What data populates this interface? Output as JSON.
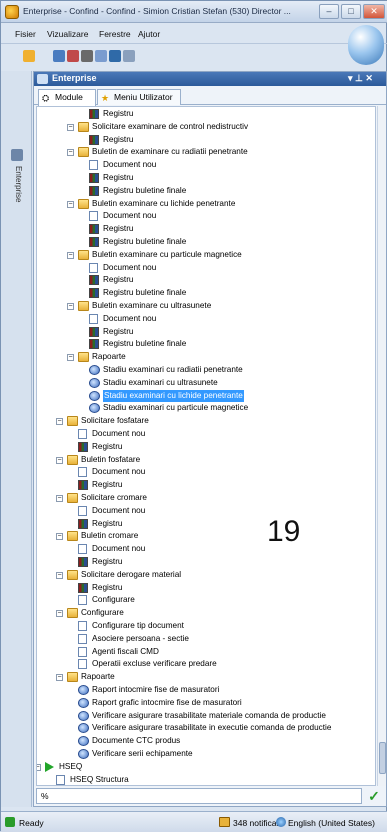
{
  "window": {
    "title": "Enterprise - Confind - Confind - Simion Cristian Stefan (530) Director ...",
    "min_label": "–",
    "max_label": "□",
    "close_label": "✕"
  },
  "menu": [
    "Fisier",
    "Vizualizare",
    "Ferestre",
    "Ajutor"
  ],
  "sidebar": {
    "tab_label": "Enterprise"
  },
  "panel": {
    "title": "Enterprise",
    "pin_label": "▾ ⊥ ✕",
    "tabs": [
      "Module",
      "Meniu Utilizator"
    ]
  },
  "tree": [
    {
      "label": "Registru",
      "icon": "register-icon",
      "level": 4,
      "expander": ""
    },
    {
      "label": "Solicitare examinare de control nedistructiv",
      "icon": "folder-icon",
      "level": 3,
      "expander": "−"
    },
    {
      "label": "Registru",
      "icon": "register-icon",
      "level": 4,
      "expander": ""
    },
    {
      "label": "Buletin de examinare cu radiatii penetrante",
      "icon": "folder-icon",
      "level": 3,
      "expander": "−"
    },
    {
      "label": "Document nou",
      "icon": "document-icon",
      "level": 4,
      "expander": ""
    },
    {
      "label": "Registru",
      "icon": "register-icon",
      "level": 4,
      "expander": ""
    },
    {
      "label": "Registru buletine finale",
      "icon": "register-icon",
      "level": 4,
      "expander": ""
    },
    {
      "label": "Buletin examinare cu lichide penetrante",
      "icon": "folder-icon",
      "level": 3,
      "expander": "−"
    },
    {
      "label": "Document nou",
      "icon": "document-icon",
      "level": 4,
      "expander": ""
    },
    {
      "label": "Registru",
      "icon": "register-icon",
      "level": 4,
      "expander": ""
    },
    {
      "label": "Registru buletine finale",
      "icon": "register-icon",
      "level": 4,
      "expander": ""
    },
    {
      "label": "Buletin examinare cu particule magnetice",
      "icon": "folder-icon",
      "level": 3,
      "expander": "−"
    },
    {
      "label": "Document nou",
      "icon": "document-icon",
      "level": 4,
      "expander": ""
    },
    {
      "label": "Registru",
      "icon": "register-icon",
      "level": 4,
      "expander": ""
    },
    {
      "label": "Registru buletine finale",
      "icon": "register-icon",
      "level": 4,
      "expander": ""
    },
    {
      "label": "Buletin examinare cu ultrasunete",
      "icon": "folder-icon",
      "level": 3,
      "expander": "−"
    },
    {
      "label": "Document nou",
      "icon": "document-icon",
      "level": 4,
      "expander": ""
    },
    {
      "label": "Registru",
      "icon": "register-icon",
      "level": 4,
      "expander": ""
    },
    {
      "label": "Registru buletine finale",
      "icon": "register-icon",
      "level": 4,
      "expander": ""
    },
    {
      "label": "Rapoarte",
      "icon": "folder-icon",
      "level": 3,
      "expander": "−"
    },
    {
      "label": "Stadiu examinari cu radiatii penetrante",
      "icon": "report-icon",
      "level": 4,
      "expander": ""
    },
    {
      "label": "Stadiu examinari cu ultrasunete",
      "icon": "report-icon",
      "level": 4,
      "expander": ""
    },
    {
      "label": "Stadiu examinari cu lichide penetrante",
      "icon": "report-icon",
      "level": 4,
      "expander": "",
      "selected": true
    },
    {
      "label": "Stadiu examinari cu particule magnetice",
      "icon": "report-icon",
      "level": 4,
      "expander": ""
    },
    {
      "label": "Solicitare fosfatare",
      "icon": "folder-icon",
      "level": 2,
      "expander": "−"
    },
    {
      "label": "Document nou",
      "icon": "document-icon",
      "level": 3,
      "expander": ""
    },
    {
      "label": "Registru",
      "icon": "register-icon",
      "level": 3,
      "expander": ""
    },
    {
      "label": "Buletin fosfatare",
      "icon": "folder-icon",
      "level": 2,
      "expander": "−"
    },
    {
      "label": "Document nou",
      "icon": "document-icon",
      "level": 3,
      "expander": ""
    },
    {
      "label": "Registru",
      "icon": "register-icon",
      "level": 3,
      "expander": ""
    },
    {
      "label": "Solicitare cromare",
      "icon": "folder-icon",
      "level": 2,
      "expander": "−"
    },
    {
      "label": "Document nou",
      "icon": "document-icon",
      "level": 3,
      "expander": ""
    },
    {
      "label": "Registru",
      "icon": "register-icon",
      "level": 3,
      "expander": ""
    },
    {
      "label": "Buletin cromare",
      "icon": "folder-icon",
      "level": 2,
      "expander": "−"
    },
    {
      "label": "Document nou",
      "icon": "document-icon",
      "level": 3,
      "expander": ""
    },
    {
      "label": "Registru",
      "icon": "register-icon",
      "level": 3,
      "expander": ""
    },
    {
      "label": "Solicitare derogare material",
      "icon": "folder-icon",
      "level": 2,
      "expander": "−"
    },
    {
      "label": "Registru",
      "icon": "register-icon",
      "level": 3,
      "expander": ""
    },
    {
      "label": "Configurare",
      "icon": "config-icon",
      "level": 3,
      "expander": ""
    },
    {
      "label": "Configurare",
      "icon": "folder-icon",
      "level": 2,
      "expander": "−"
    },
    {
      "label": "Configurare tip document",
      "icon": "config-icon",
      "level": 3,
      "expander": ""
    },
    {
      "label": "Asociere persoana - sectie",
      "icon": "config-icon",
      "level": 3,
      "expander": ""
    },
    {
      "label": "Agenti fiscali CMD",
      "icon": "config-icon",
      "level": 3,
      "expander": ""
    },
    {
      "label": "Operatii excluse verificare predare",
      "icon": "config-icon",
      "level": 3,
      "expander": ""
    },
    {
      "label": "Rapoarte",
      "icon": "folder-icon",
      "level": 2,
      "expander": "−"
    },
    {
      "label": "Raport intocmire fise de masuratori",
      "icon": "report-icon",
      "level": 3,
      "expander": ""
    },
    {
      "label": "Raport grafic intocmire fise de masuratori",
      "icon": "report-icon",
      "level": 3,
      "expander": ""
    },
    {
      "label": "Verificare asigurare trasabilitate materiale comanda de productie",
      "icon": "report-icon",
      "level": 3,
      "expander": ""
    },
    {
      "label": "Verificare asigurare trasabilitate in executie comanda de productie",
      "icon": "report-icon",
      "level": 3,
      "expander": ""
    },
    {
      "label": "Documente CTC produs",
      "icon": "report-icon",
      "level": 3,
      "expander": ""
    },
    {
      "label": "Verificare serii echipamente",
      "icon": "report-icon",
      "level": 3,
      "expander": ""
    },
    {
      "label": "HSEQ",
      "icon": "hseq-icon",
      "level": 0,
      "expander": "−"
    },
    {
      "label": "HSEQ Structura",
      "icon": "document-icon",
      "level": 1,
      "expander": ""
    }
  ],
  "overlay_number": "19",
  "search": {
    "value": "%"
  },
  "status": {
    "ready": "Ready",
    "notifications": "348 notificari",
    "language": "English (United States)"
  }
}
